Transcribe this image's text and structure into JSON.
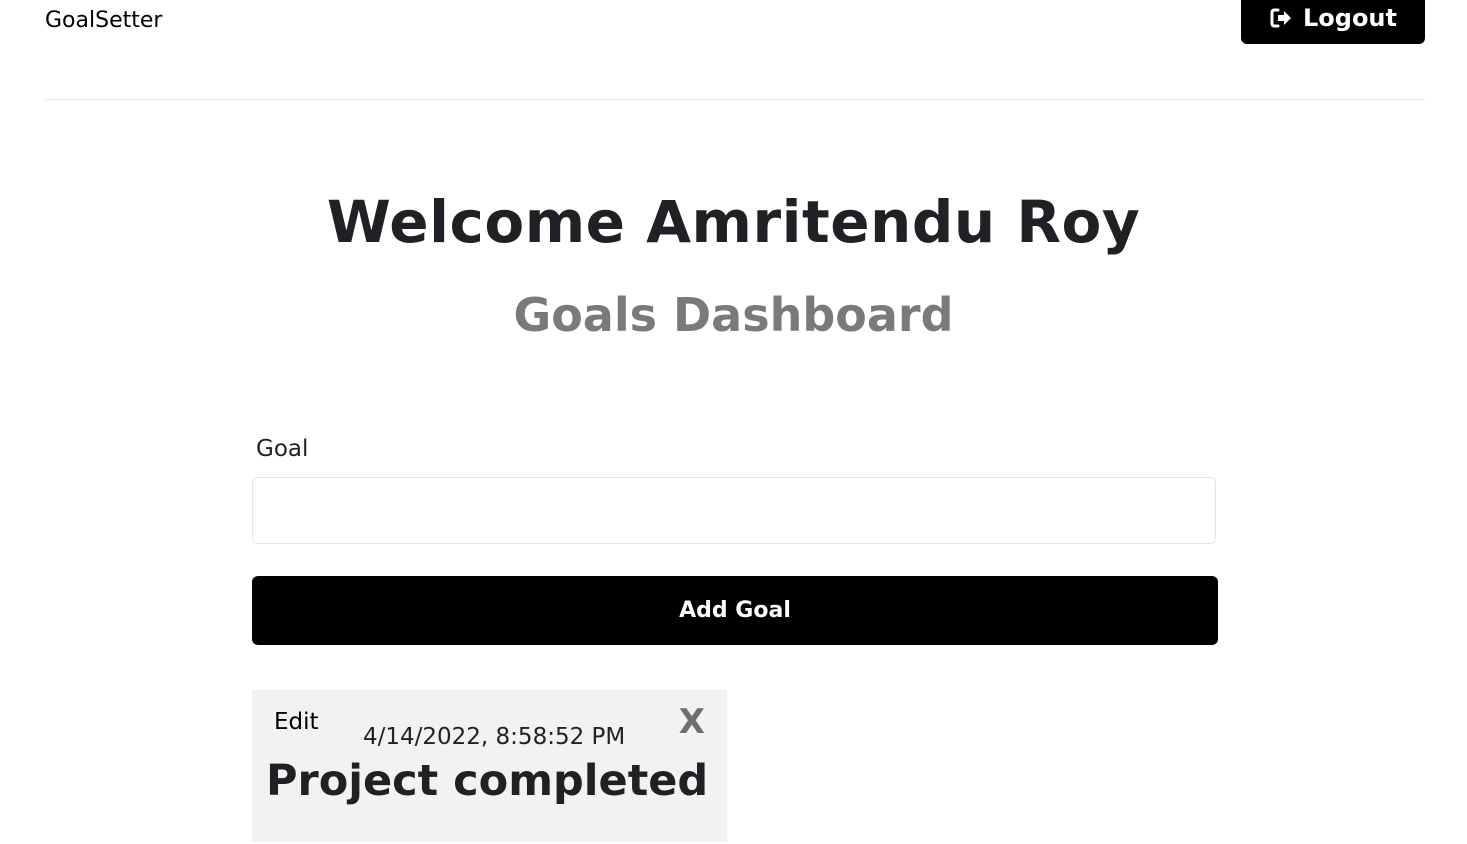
{
  "header": {
    "brand": "GoalSetter",
    "logout_label": "Logout",
    "logout_icon": "sign-out-icon"
  },
  "main": {
    "welcome": "Welcome Amritendu Roy",
    "subtitle": "Goals Dashboard"
  },
  "form": {
    "goal_label": "Goal",
    "goal_value": "",
    "add_label": "Add Goal"
  },
  "goals": [
    {
      "edit_label": "Edit",
      "date": "4/14/2022, 8:58:52 PM",
      "delete_label": "X",
      "text": "Project completed"
    }
  ],
  "colors": {
    "button_bg": "#000000",
    "subtitle": "#7a7a7a",
    "card_bg": "#f2f2f2"
  }
}
